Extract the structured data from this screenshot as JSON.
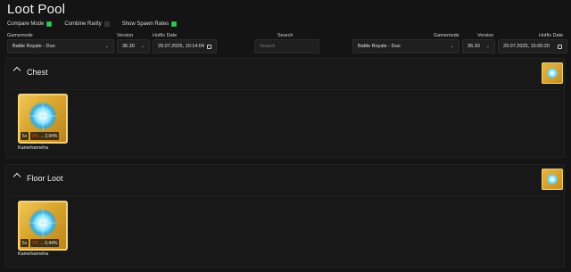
{
  "page": {
    "title": "Loot Pool"
  },
  "toggles": [
    {
      "label": "Compare Mode",
      "checked": true
    },
    {
      "label": "Combine Rarity",
      "checked": false
    },
    {
      "label": "Show Spawn Rates",
      "checked": true
    }
  ],
  "filters": {
    "left": {
      "gamemode_label": "Gamemode",
      "gamemode_value": "Battle Royale - Duo",
      "version_label": "Version",
      "version_value": "36.30",
      "hotfix_label": "Hotfix Date",
      "hotfix_value": "29.07.2025, 10:14:04"
    },
    "search": {
      "label": "Search",
      "placeholder": "Search"
    },
    "right": {
      "gamemode_label": "Gamemode",
      "gamemode_value": "Battle Royale - Duo",
      "version_label": "Version",
      "version_value": "36.30",
      "hotfix_label": "Hotfix Date",
      "hotfix_value": "29.07.2025, 15:00:20"
    }
  },
  "sections": [
    {
      "title": "Chest",
      "items": [
        {
          "name": "Kamehameha",
          "quantity": "5x",
          "old_rate": "0%",
          "arrow": "→",
          "new_rate": "2,94%"
        }
      ]
    },
    {
      "title": "Floor Loot",
      "items": [
        {
          "name": "Kamehameha",
          "quantity": "5x",
          "old_rate": "0%",
          "arrow": "→",
          "new_rate": "0,44%"
        }
      ]
    }
  ],
  "colors": {
    "background": "#141414",
    "panel": "#181818",
    "accent_check": "#34c759",
    "rarity_gold": "#d9a52d",
    "rate_old": "#d14a3a"
  }
}
